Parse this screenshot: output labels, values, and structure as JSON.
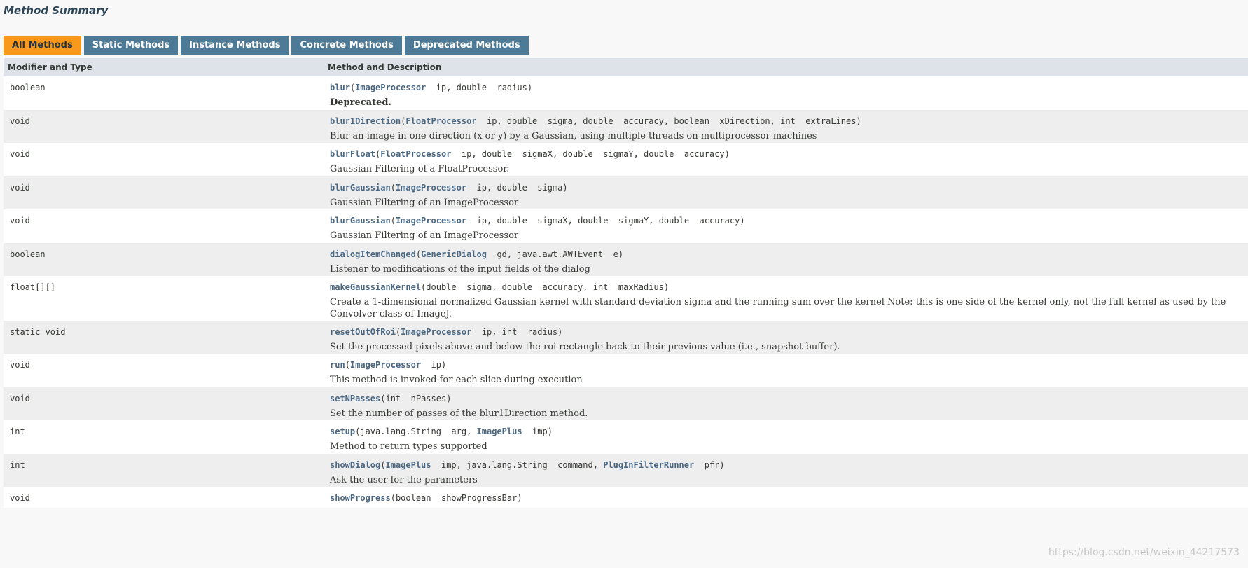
{
  "section_title": "Method Summary",
  "tabs": [
    {
      "label": "All Methods",
      "active": true
    },
    {
      "label": "Static Methods",
      "active": false
    },
    {
      "label": "Instance Methods",
      "active": false
    },
    {
      "label": "Concrete Methods",
      "active": false
    },
    {
      "label": "Deprecated Methods",
      "active": false
    }
  ],
  "columns": {
    "modifier": "Modifier and Type",
    "method": "Method and Description"
  },
  "rows": [
    {
      "type": "boolean",
      "name": "blur",
      "params": [
        {
          "t": "ImageProcessor",
          "link": true,
          "n": "ip"
        },
        {
          "t": "double",
          "link": false,
          "n": "radius"
        }
      ],
      "desc": "Deprecated.",
      "deprecated": true
    },
    {
      "type": "void",
      "name": "blur1Direction",
      "params": [
        {
          "t": "FloatProcessor",
          "link": true,
          "n": "ip"
        },
        {
          "t": "double",
          "link": false,
          "n": "sigma"
        },
        {
          "t": "double",
          "link": false,
          "n": "accuracy"
        },
        {
          "t": "boolean",
          "link": false,
          "n": "xDirection"
        },
        {
          "t": "int",
          "link": false,
          "n": "extraLines"
        }
      ],
      "desc": "Blur an image in one direction (x or y) by a Gaussian, using multiple threads on multiprocessor machines"
    },
    {
      "type": "void",
      "name": "blurFloat",
      "params": [
        {
          "t": "FloatProcessor",
          "link": true,
          "n": "ip"
        },
        {
          "t": "double",
          "link": false,
          "n": "sigmaX"
        },
        {
          "t": "double",
          "link": false,
          "n": "sigmaY"
        },
        {
          "t": "double",
          "link": false,
          "n": "accuracy"
        }
      ],
      "desc": "Gaussian Filtering of a FloatProcessor."
    },
    {
      "type": "void",
      "name": "blurGaussian",
      "params": [
        {
          "t": "ImageProcessor",
          "link": true,
          "n": "ip"
        },
        {
          "t": "double",
          "link": false,
          "n": "sigma"
        }
      ],
      "desc": "Gaussian Filtering of an ImageProcessor"
    },
    {
      "type": "void",
      "name": "blurGaussian",
      "params": [
        {
          "t": "ImageProcessor",
          "link": true,
          "n": "ip"
        },
        {
          "t": "double",
          "link": false,
          "n": "sigmaX"
        },
        {
          "t": "double",
          "link": false,
          "n": "sigmaY"
        },
        {
          "t": "double",
          "link": false,
          "n": "accuracy"
        }
      ],
      "desc": "Gaussian Filtering of an ImageProcessor"
    },
    {
      "type": "boolean",
      "name": "dialogItemChanged",
      "params": [
        {
          "t": "GenericDialog",
          "link": true,
          "n": "gd"
        },
        {
          "t": "java.awt.AWTEvent",
          "link": false,
          "n": "e"
        }
      ],
      "desc": "Listener to modifications of the input fields of the dialog"
    },
    {
      "type": "float[][]",
      "name": "makeGaussianKernel",
      "params": [
        {
          "t": "double",
          "link": false,
          "n": "sigma"
        },
        {
          "t": "double",
          "link": false,
          "n": "accuracy"
        },
        {
          "t": "int",
          "link": false,
          "n": "maxRadius"
        }
      ],
      "desc": "Create a 1-dimensional normalized Gaussian kernel with standard deviation sigma and the running sum over the kernel Note: this is one side of the kernel only, not the full kernel as used by the Convolver class of ImageJ."
    },
    {
      "type": "static void",
      "name": "resetOutOfRoi",
      "params": [
        {
          "t": "ImageProcessor",
          "link": true,
          "n": "ip"
        },
        {
          "t": "int",
          "link": false,
          "n": "radius"
        }
      ],
      "desc": "Set the processed pixels above and below the roi rectangle back to their previous value (i.e., snapshot buffer)."
    },
    {
      "type": "void",
      "name": "run",
      "params": [
        {
          "t": "ImageProcessor",
          "link": true,
          "n": "ip"
        }
      ],
      "desc": "This method is invoked for each slice during execution"
    },
    {
      "type": "void",
      "name": "setNPasses",
      "params": [
        {
          "t": "int",
          "link": false,
          "n": "nPasses"
        }
      ],
      "desc": "Set the number of passes of the blur1Direction method."
    },
    {
      "type": "int",
      "name": "setup",
      "params": [
        {
          "t": "java.lang.String",
          "link": false,
          "n": "arg"
        },
        {
          "t": "ImagePlus",
          "link": true,
          "n": "imp"
        }
      ],
      "desc": "Method to return types supported"
    },
    {
      "type": "int",
      "name": "showDialog",
      "params": [
        {
          "t": "ImagePlus",
          "link": true,
          "n": "imp"
        },
        {
          "t": "java.lang.String",
          "link": false,
          "n": "command"
        },
        {
          "t": "PlugInFilterRunner",
          "link": true,
          "n": "pfr"
        }
      ],
      "desc": "Ask the user for the parameters"
    },
    {
      "type": "void",
      "name": "showProgress",
      "params": [
        {
          "t": "boolean",
          "link": false,
          "n": "showProgressBar"
        }
      ],
      "desc": ""
    }
  ],
  "watermark": "https://blog.csdn.net/weixin_44217573"
}
